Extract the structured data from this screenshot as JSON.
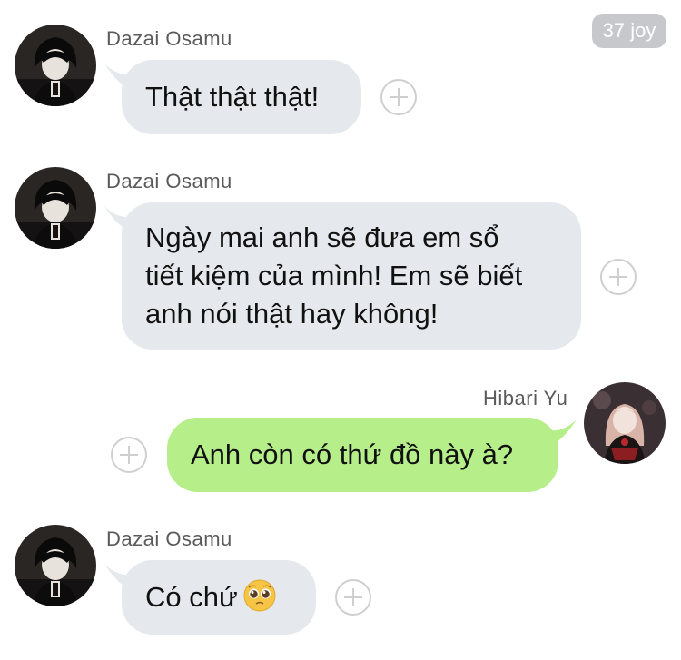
{
  "reaction_badge": "37 joy",
  "messages": [
    {
      "sender": "Dazai Osamu",
      "lines": [
        "Thật thật thật!"
      ]
    },
    {
      "sender": "Dazai Osamu",
      "lines": [
        "Ngày mai anh sẽ đưa em sổ",
        "tiết kiệm của mình! Em sẽ biết",
        "anh nói thật hay không!"
      ]
    },
    {
      "sender": "Hibari Yu",
      "lines": [
        "Anh còn có thứ đồ này à?"
      ]
    },
    {
      "sender": "Dazai Osamu",
      "text": "Có chứ",
      "emoji": "pleading-face"
    }
  ],
  "colors": {
    "incoming_bubble": "#e5e8ec",
    "outgoing_bubble": "#b6ee8a",
    "badge": "#c6c8cc"
  }
}
